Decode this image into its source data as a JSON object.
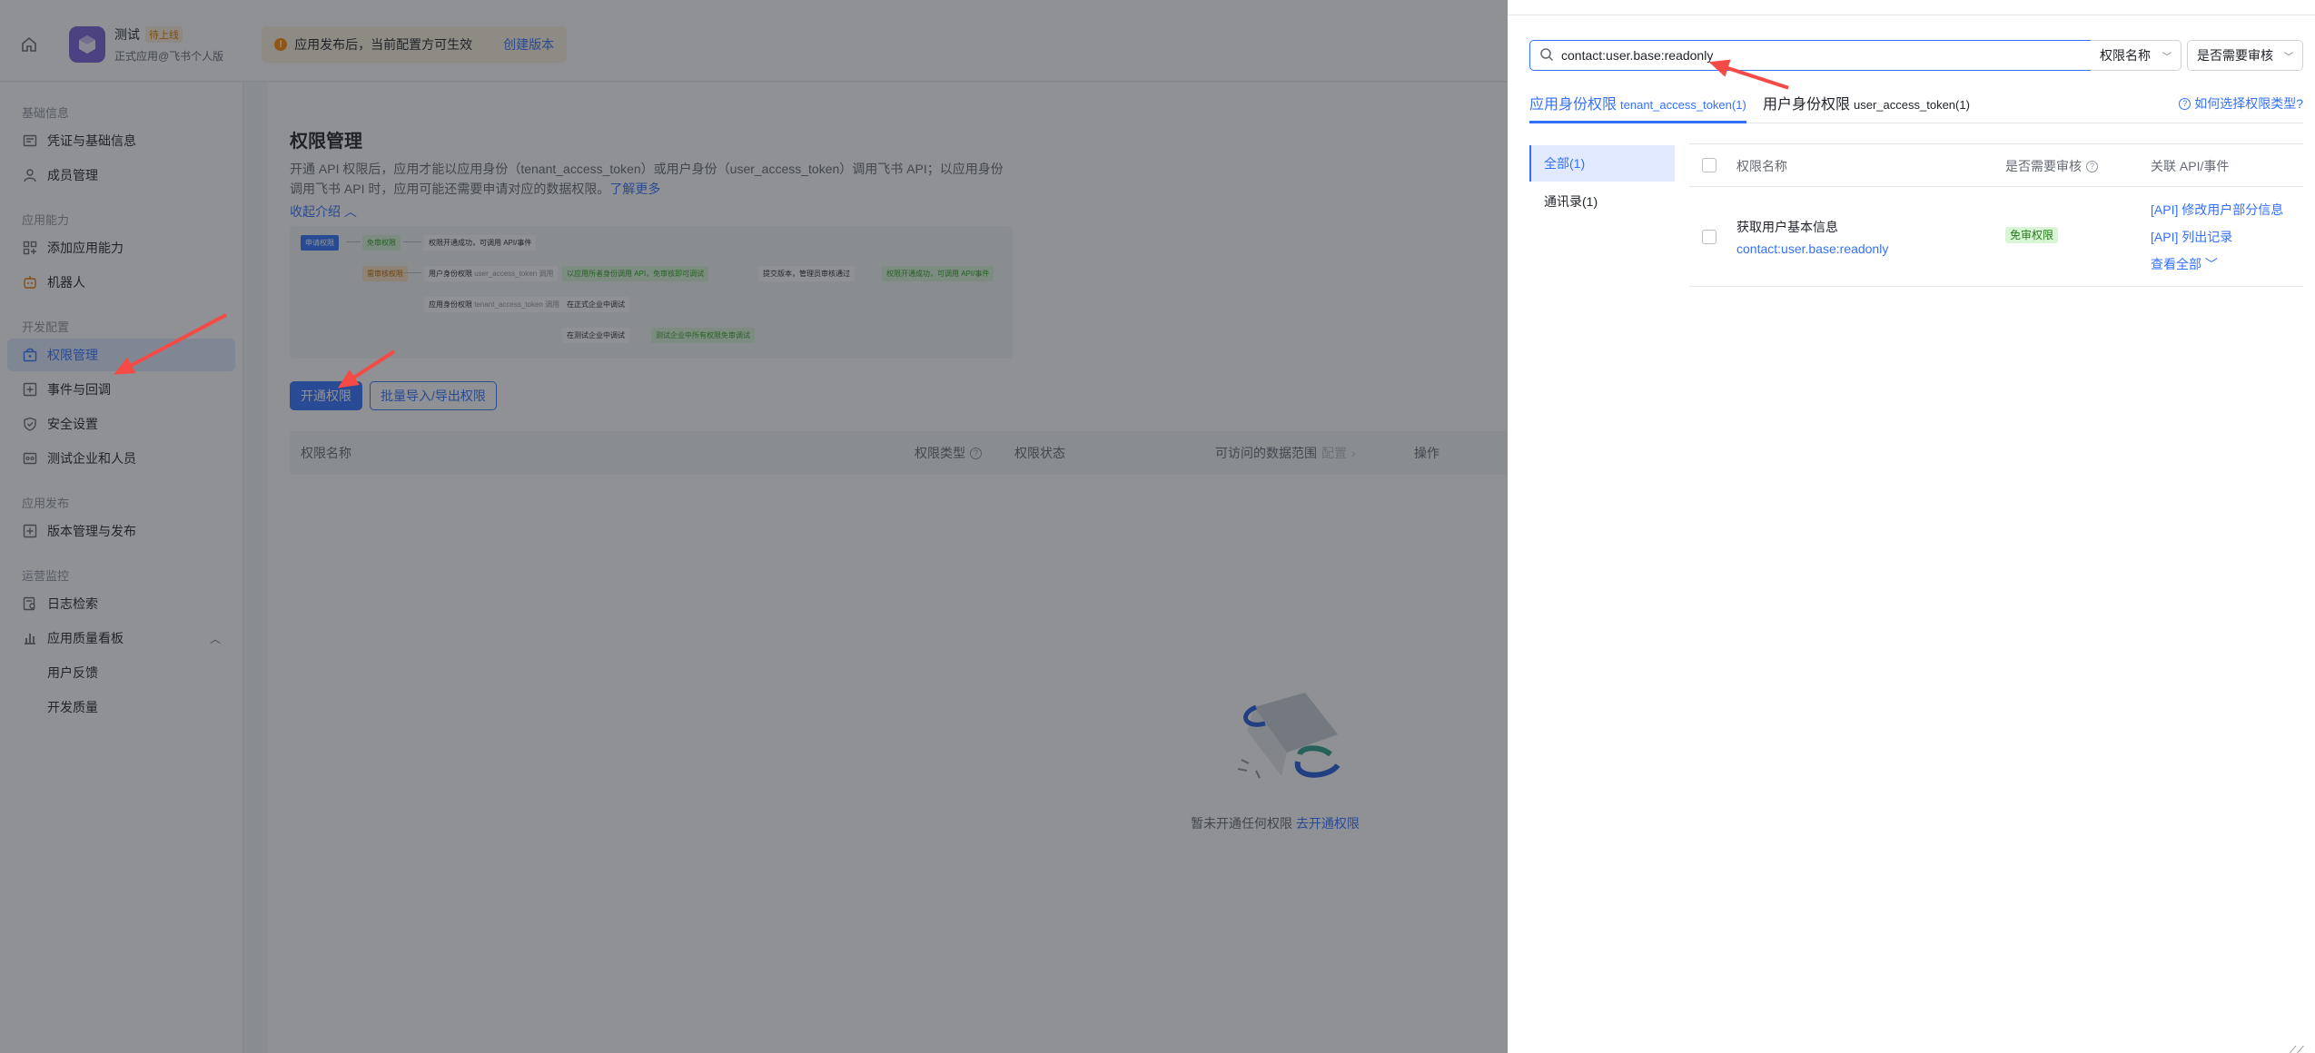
{
  "header": {
    "app_name": "测试",
    "app_status": "待上线",
    "app_subtitle": "正式应用@飞书个人版",
    "banner_text": "应用发布后，当前配置方可生效",
    "banner_link": "创建版本"
  },
  "sidebar": {
    "groups": [
      {
        "title": "基础信息",
        "items": [
          "凭证与基础信息",
          "成员管理"
        ]
      },
      {
        "title": "应用能力",
        "items": [
          "添加应用能力",
          "机器人"
        ]
      },
      {
        "title": "开发配置",
        "items": [
          "权限管理",
          "事件与回调",
          "安全设置",
          "测试企业和人员"
        ]
      },
      {
        "title": "应用发布",
        "items": [
          "版本管理与发布"
        ]
      },
      {
        "title": "运营监控",
        "items": [
          "日志检索",
          "应用质量看板"
        ]
      }
    ],
    "sub_items": [
      "用户反馈",
      "开发质量"
    ],
    "active": "权限管理"
  },
  "main": {
    "title": "权限管理",
    "desc": "开通 API 权限后，应用才能以应用身份（tenant_access_token）或用户身份（user_access_token）调用飞书 API；以应用身份调用飞书 API 时，应用可能还需要申请对应的数据权限。",
    "desc_link": "了解更多",
    "collapse": "收起介绍",
    "diagram": {
      "apply": "申请权限",
      "free": "免审权限",
      "free_result": "权限开通成功，可调用 API/事件",
      "review": "需审核权限",
      "user_identity": "用户身份权限",
      "user_token": "user_access_token 调用",
      "user_result": "以应用所者身份调用 API，免审核即可调试",
      "submit": "提交版本，管理员审核通过",
      "final_result": "权限开通成功，可调用 API/事件",
      "app_identity": "应用身份权限",
      "app_token": "tenant_access_token 调用",
      "formal": "在正式企业中调试",
      "test": "在测试企业中调试",
      "test_result": "测试企业中所有权限免审调试"
    },
    "btn_enable": "开通权限",
    "btn_batch": "批量导入/导出权限",
    "columns": [
      "权限名称",
      "权限类型",
      "权限状态",
      "可访问的数据范围",
      "配置",
      "操作"
    ],
    "empty_text": "暂未开通任何权限",
    "empty_link": "去开通权限"
  },
  "drawer": {
    "search_value": "contact:user.base:readonly",
    "select_name": "权限名称",
    "select_review": "是否需要审核",
    "tabs": [
      {
        "label": "应用身份权限",
        "token": "tenant_access_token(1)"
      },
      {
        "label": "用户身份权限",
        "token": "user_access_token(1)"
      }
    ],
    "help": "如何选择权限类型?",
    "categories": [
      "全部(1)",
      "通讯录(1)"
    ],
    "columns": [
      "权限名称",
      "是否需要审核",
      "关联 API/事件"
    ],
    "rows": [
      {
        "name": "获取用户基本信息",
        "code": "contact:user.base:readonly",
        "review": "免审权限",
        "apis": [
          "[API] 修改用户部分信息",
          "[API] 列出记录"
        ],
        "more": "查看全部"
      }
    ]
  },
  "colors": {
    "primary": "#3370ff",
    "active_bg": "#e1eaff",
    "arrow": "#f54a45",
    "free_tag": "#d9f5d6"
  }
}
